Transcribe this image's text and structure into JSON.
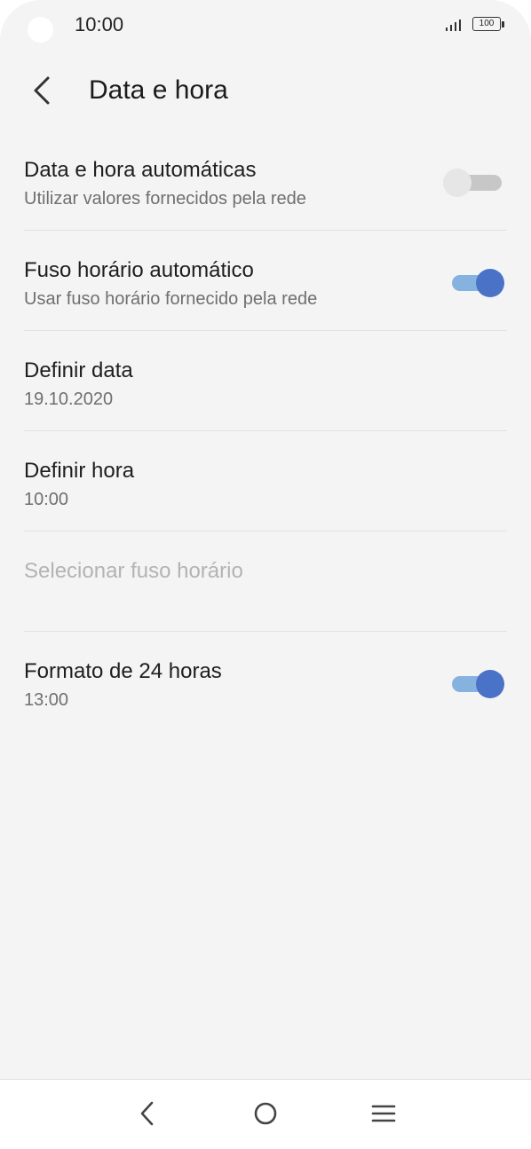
{
  "status_bar": {
    "time": "10:00",
    "battery": "100"
  },
  "header": {
    "title": "Data e hora"
  },
  "settings": [
    {
      "title": "Data e hora automáticas",
      "subtitle": "Utilizar valores fornecidos pela rede",
      "toggle": "off"
    },
    {
      "title": "Fuso horário automático",
      "subtitle": "Usar fuso horário fornecido pela rede",
      "toggle": "on"
    },
    {
      "title": "Definir data",
      "subtitle": "19.10.2020"
    },
    {
      "title": "Definir hora",
      "subtitle": "10:00"
    },
    {
      "title": "Selecionar fuso horário",
      "disabled": true
    },
    {
      "title": "Formato de 24 horas",
      "subtitle": "13:00",
      "toggle": "on"
    }
  ],
  "icons": {
    "back": "arrow-back-icon",
    "nav_back": "chevron-left-icon",
    "nav_home": "circle-home-icon",
    "nav_menu": "menu-lines-icon",
    "signal": "signal-icon",
    "battery": "battery-icon"
  },
  "colors": {
    "toggle_on_thumb": "#4a72c7",
    "toggle_on_track": "#86b2e0",
    "toggle_off_thumb": "#e6e6e6",
    "toggle_off_track": "#c7c7c7",
    "background": "#f4f4f4"
  }
}
